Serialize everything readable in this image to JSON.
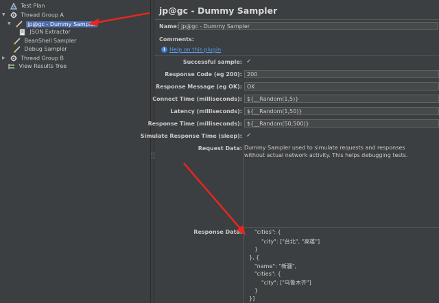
{
  "tree": {
    "items": [
      {
        "label": "Test Plan",
        "icon": "test-plan-icon"
      },
      {
        "label": "Thread Group A",
        "icon": "thread-group-icon"
      },
      {
        "label": "jp@gc - Dummy Sampler",
        "icon": "dummy-sampler-icon"
      },
      {
        "label": "JSON Extractor",
        "icon": "json-extractor-icon"
      },
      {
        "label": "BeanShell Sampler",
        "icon": "sampler-icon"
      },
      {
        "label": "Debug Sampler",
        "icon": "sampler-icon"
      },
      {
        "label": "Thread Group B",
        "icon": "thread-group-icon"
      },
      {
        "label": "View Results Tree",
        "icon": "results-tree-icon"
      }
    ]
  },
  "panel": {
    "title": "jp@gc - Dummy Sampler",
    "name_label": "Name:",
    "name_value": "jp@gc - Dummy Sampler",
    "comments_label": "Comments:",
    "help_link": "Help on this plugin",
    "successful_sample_label": "Successful sample:",
    "response_code_label": "Response Code (eg 200):",
    "response_code_value": "200",
    "response_message_label": "Response Message (eg OK):",
    "response_message_value": "OK",
    "connect_time_label": "Connect Time (milliseconds):",
    "connect_time_value": "${__Random(1,5)}",
    "latency_label": "Latency (milliseconds):",
    "latency_value": "${__Random(1,50)}",
    "response_time_label": "Response Time (milliseconds):",
    "response_time_value": "${__Random(50,500)}",
    "simulate_label": "Simulate Response Time (sleep):",
    "request_data_label": "Request Data:",
    "request_data_value": "Dummy Sampler used to simulate requests and responses\nwithout actual network activity. This helps debugging tests.",
    "response_data_label": "Response Data:",
    "response_lines": [
      "\"cities\": {",
      "\"city\": [\"台北\", \"高雄\"]",
      "}",
      "}, {",
      "\"name\": \"新疆\",",
      "\"cities\": {",
      "\"city\": [\"乌鲁木齐\"]",
      "}",
      "}]"
    ]
  },
  "colors": {
    "arrow": "#e8261f",
    "selection": "#4b6eaf",
    "background": "#3c3f41"
  }
}
